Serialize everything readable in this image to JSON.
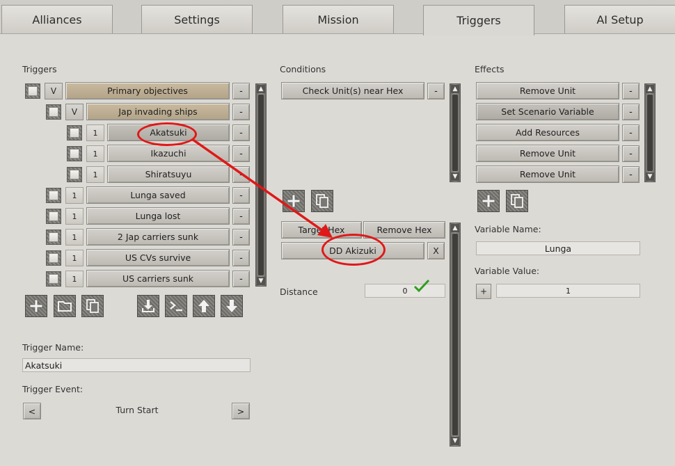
{
  "tabs": [
    {
      "label": "Alliances"
    },
    {
      "label": "Settings"
    },
    {
      "label": "Mission"
    },
    {
      "label": "Triggers"
    },
    {
      "label": "AI Setup"
    }
  ],
  "active_tab": "Triggers",
  "triggers": {
    "heading": "Triggers",
    "items": [
      {
        "toggle": "V",
        "label": "Primary objectives",
        "minus": "-"
      },
      {
        "toggle": "V",
        "label": "Jap invading ships",
        "minus": "-"
      },
      {
        "count": "1",
        "label": "Akatsuki",
        "minus": "-"
      },
      {
        "count": "1",
        "label": "Ikazuchi",
        "minus": "-"
      },
      {
        "count": "1",
        "label": "Shiratsuyu",
        "minus": "-"
      },
      {
        "count": "1",
        "label": "Lunga saved",
        "minus": "-"
      },
      {
        "count": "1",
        "label": "Lunga lost",
        "minus": "-"
      },
      {
        "count": "1",
        "label": "2 Jap carriers sunk",
        "minus": "-"
      },
      {
        "count": "1",
        "label": "US CVs survive",
        "minus": "-"
      },
      {
        "count": "1",
        "label": "US carriers sunk",
        "minus": "-"
      }
    ],
    "trigger_name_label": "Trigger Name:",
    "trigger_name_value": "Akatsuki",
    "trigger_event_label": "Trigger Event:",
    "trigger_event_value": "Turn Start",
    "prev": "<",
    "next": ">"
  },
  "conditions": {
    "heading": "Conditions",
    "items": [
      {
        "label": "Check Unit(s) near Hex",
        "minus": "-"
      }
    ],
    "target_hex": "Target Hex",
    "remove_hex": "Remove Hex",
    "unit": "DD Akizuki",
    "unit_remove": "X",
    "distance_label": "Distance",
    "distance_value": "0"
  },
  "effects": {
    "heading": "Effects",
    "items": [
      {
        "label": "Remove Unit",
        "minus": "-"
      },
      {
        "label": "Set Scenario Variable",
        "minus": "-"
      },
      {
        "label": "Add Resources",
        "minus": "-"
      },
      {
        "label": "Remove Unit",
        "minus": "-"
      },
      {
        "label": "Remove Unit",
        "minus": "-"
      }
    ],
    "variable_name_label": "Variable Name:",
    "variable_name_value": "Lunga",
    "variable_value_label": "Variable Value:",
    "variable_value": "1",
    "plus": "+"
  },
  "colors": {
    "annotation": "#e01818",
    "checkmark": "#2e9e1e"
  }
}
